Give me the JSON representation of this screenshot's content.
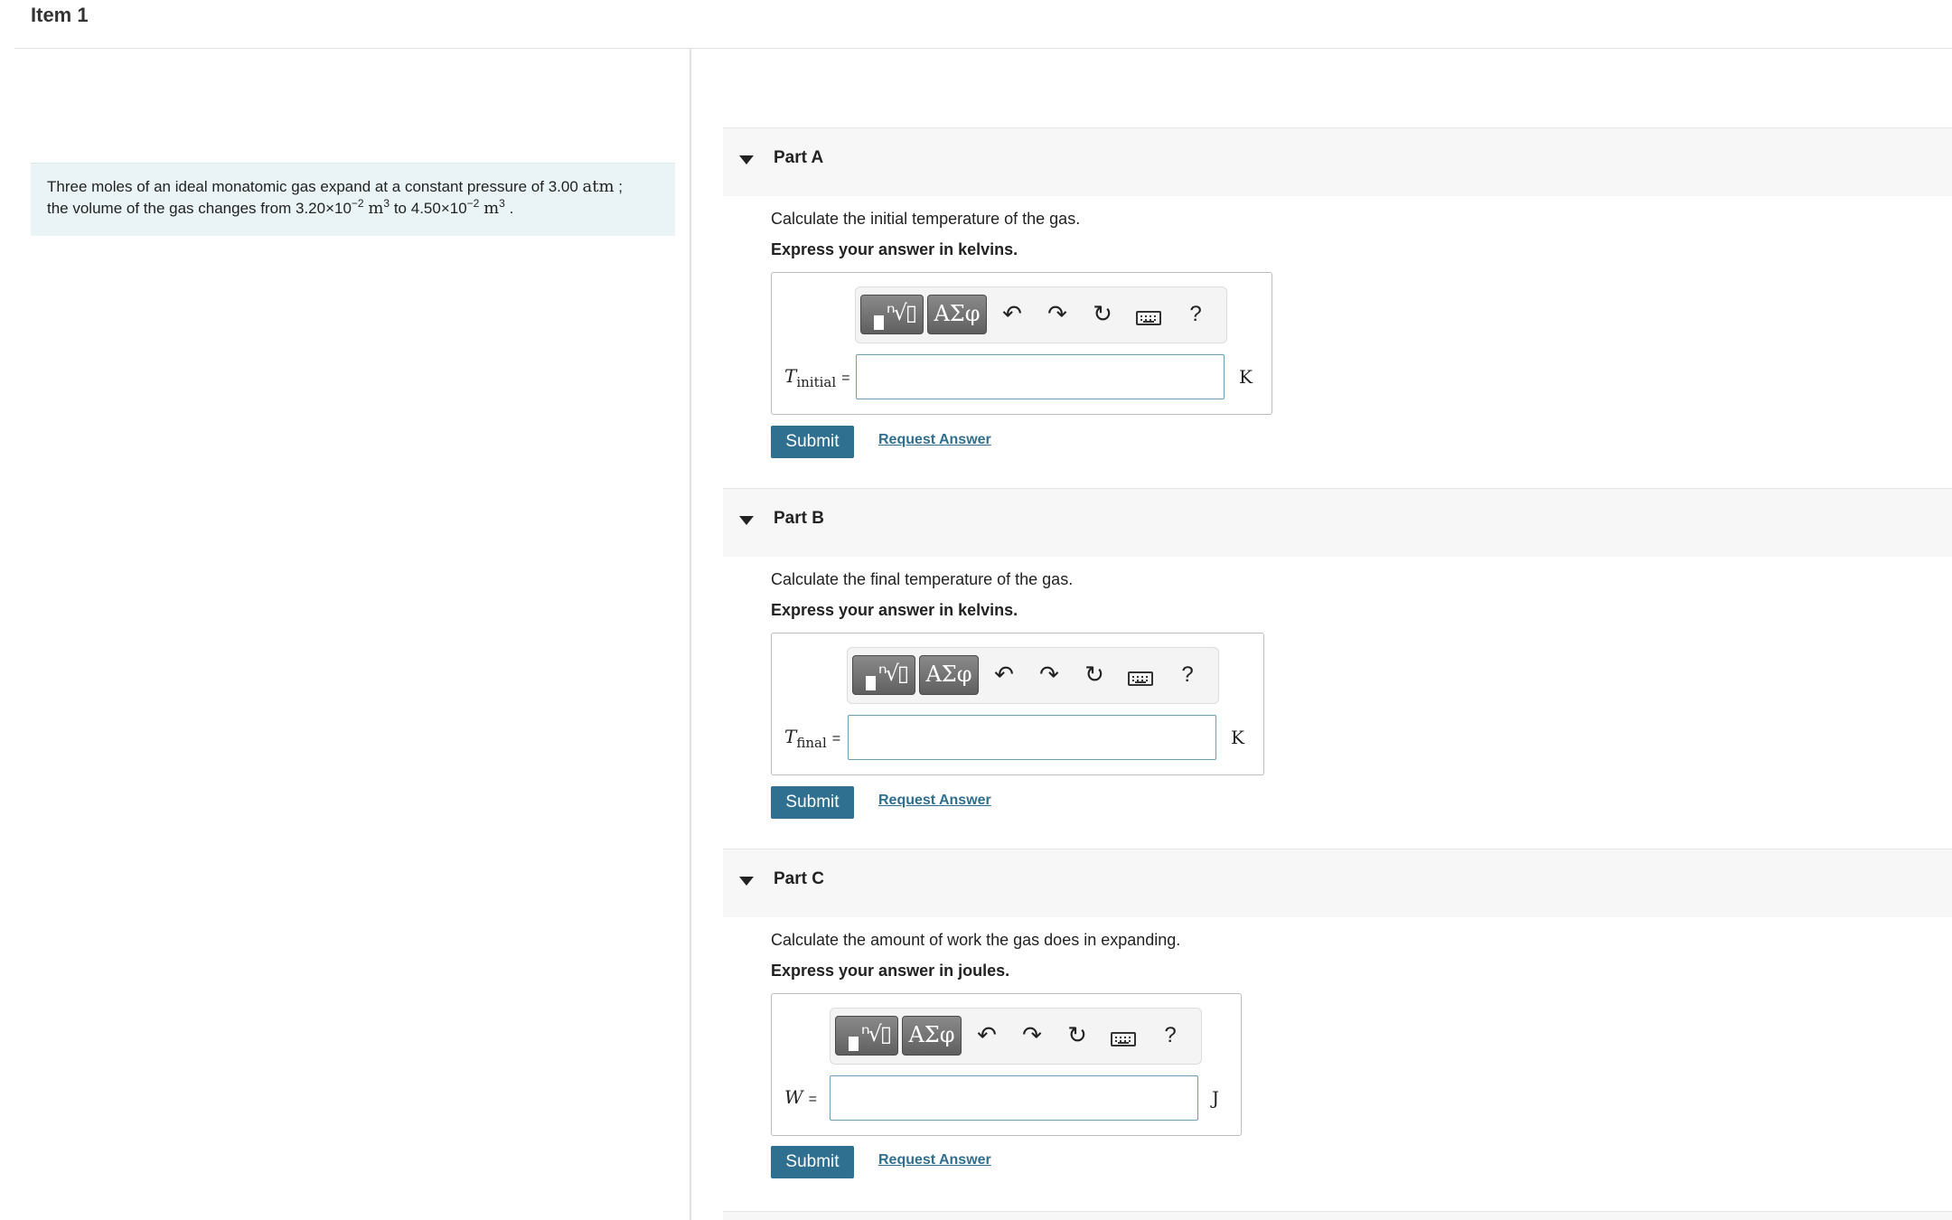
{
  "item": {
    "title": "Item 1"
  },
  "problem": {
    "text_1": "Three moles of an ideal monatomic gas expand at a constant pressure of 3.00 ",
    "pressure_unit": "atm",
    "text_2": " ;",
    "text_3": "the volume of the gas changes from 3.20×10",
    "exp_1": "−2",
    "vol_unit": "m",
    "cube": "3",
    "text_4": " to 4.50×10",
    "exp_2": "−2",
    "text_5": " ."
  },
  "toolbar": {
    "template_icon": "templates-icon",
    "greek_label": "ΑΣφ",
    "undo_icon": "undo-icon",
    "redo_icon": "redo-icon",
    "reset_icon": "reset-icon",
    "keyboard_icon": "keyboard-icon",
    "help_label": "?"
  },
  "parts": [
    {
      "title": "Part A",
      "prompt": "Calculate the initial temperature of the gas.",
      "instruction": "Express your answer in kelvins.",
      "var": "T",
      "sub": "initial",
      "eq": "=",
      "value": "",
      "unit": "K",
      "submit": "Submit",
      "request": "Request Answer"
    },
    {
      "title": "Part B",
      "prompt": "Calculate the final temperature of the gas.",
      "instruction": "Express your answer in kelvins.",
      "var": "T",
      "sub": "final",
      "eq": "=",
      "value": "",
      "unit": "K",
      "submit": "Submit",
      "request": "Request Answer"
    },
    {
      "title": "Part C",
      "prompt": "Calculate the amount of work the gas does in expanding.",
      "instruction": "Express your answer in joules.",
      "var": "W",
      "sub": "",
      "eq": "=",
      "value": "",
      "unit": "J",
      "submit": "Submit",
      "request": "Request Answer"
    }
  ]
}
